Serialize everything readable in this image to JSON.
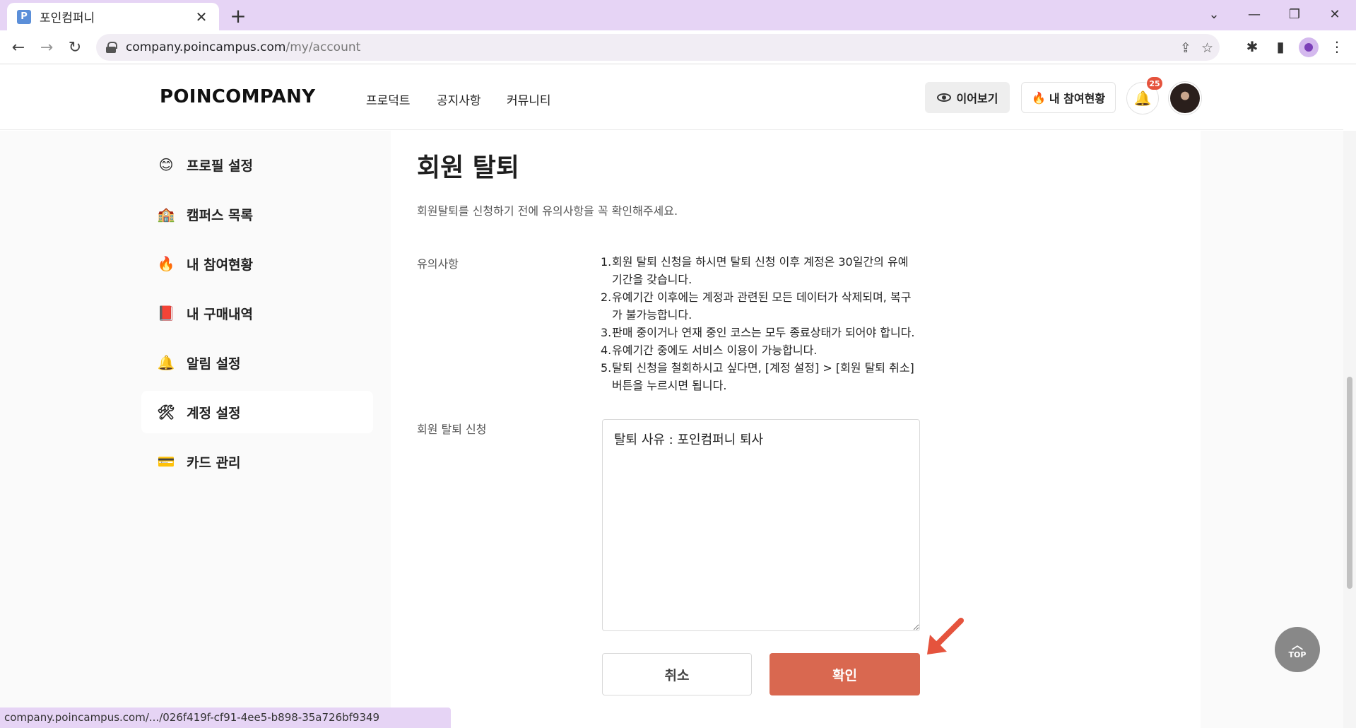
{
  "browser": {
    "tab_title": "포인컴퍼니",
    "favicon_letter": "P",
    "url_host": "company.poincampus.com",
    "url_path": "/my/account"
  },
  "header": {
    "logo": "POINCOMPANY",
    "nav": [
      "프로덕트",
      "공지사항",
      "커뮤니티"
    ],
    "continue_label": "이어보기",
    "participation_label": "내 참여현황",
    "notification_count": "25"
  },
  "sidebar": {
    "items": [
      {
        "icon": "😊",
        "label": "프로필 설정"
      },
      {
        "icon": "🏫",
        "label": "캠퍼스 목록"
      },
      {
        "icon": "🔥",
        "label": "내 참여현황"
      },
      {
        "icon": "📕",
        "label": "내 구매내역"
      },
      {
        "icon": "🔔",
        "label": "알림 설정"
      },
      {
        "icon": "🛠",
        "label": "계정 설정"
      },
      {
        "icon": "💳",
        "label": "카드 관리"
      }
    ]
  },
  "main": {
    "title": "회원 탈퇴",
    "description": "회원탈퇴를 신청하기 전에 유의사항을 꼭 확인해주세요.",
    "notice_label": "유의사항",
    "notices": [
      {
        "num": "1.",
        "text": "회원 탈퇴 신청을 하시면 탈퇴 신청 이후 계정은 30일간의 유예기간을 갖습니다."
      },
      {
        "num": "2.",
        "text": "유예기간 이후에는 계정과 관련된 모든 데이터가 삭제되며, 복구가 불가능합니다."
      },
      {
        "num": "3.",
        "text": "판매 중이거나 연재 중인 코스는 모두 종료상태가 되어야 합니다."
      },
      {
        "num": "4.",
        "text": "유예기간 중에도 서비스 이용이 가능합니다."
      },
      {
        "num": "5.",
        "text": "탈퇴 신청을 철회하시고 싶다면, [계정 설정] > [회원 탈퇴 취소] 버튼을 누르시면 됩니다."
      }
    ],
    "apply_label": "회원 탈퇴 신청",
    "reason_value": "탈퇴 사유 : 포인컴퍼니 퇴사",
    "cancel_label": "취소",
    "confirm_label": "확인"
  },
  "top_button_label": "TOP",
  "status_url": "company.poincampus.com/.../026f419f-cf91-4ee5-b898-35a726bf9349",
  "colors": {
    "accent": "#d96850",
    "tabbar": "#e6d4f5",
    "badge": "#e5533d",
    "annotation_arrow": "#e5533d"
  }
}
